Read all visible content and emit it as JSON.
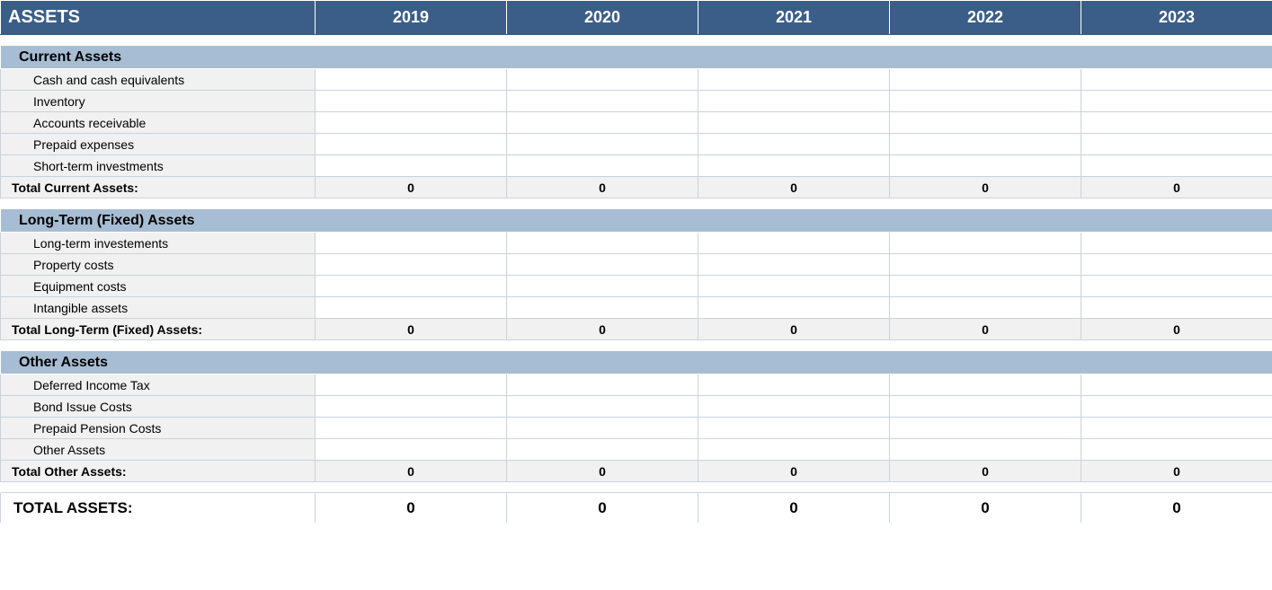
{
  "header": {
    "title": "ASSETS",
    "years": [
      "2019",
      "2020",
      "2021",
      "2022",
      "2023"
    ]
  },
  "sections": [
    {
      "title": "Current Assets",
      "items": [
        {
          "label": "Cash and cash equivalents",
          "values": [
            "",
            "",
            "",
            "",
            ""
          ]
        },
        {
          "label": "Inventory",
          "values": [
            "",
            "",
            "",
            "",
            ""
          ]
        },
        {
          "label": "Accounts receivable",
          "values": [
            "",
            "",
            "",
            "",
            ""
          ]
        },
        {
          "label": "Prepaid expenses",
          "values": [
            "",
            "",
            "",
            "",
            ""
          ]
        },
        {
          "label": "Short-term investments",
          "values": [
            "",
            "",
            "",
            "",
            ""
          ]
        }
      ],
      "total_label": "Total Current Assets:",
      "total_values": [
        "0",
        "0",
        "0",
        "0",
        "0"
      ]
    },
    {
      "title": "Long-Term (Fixed) Assets",
      "items": [
        {
          "label": "Long-term investements",
          "values": [
            "",
            "",
            "",
            "",
            ""
          ]
        },
        {
          "label": "Property costs",
          "values": [
            "",
            "",
            "",
            "",
            ""
          ]
        },
        {
          "label": "Equipment costs",
          "values": [
            "",
            "",
            "",
            "",
            ""
          ]
        },
        {
          "label": "Intangible assets",
          "values": [
            "",
            "",
            "",
            "",
            ""
          ]
        }
      ],
      "total_label": "Total Long-Term (Fixed) Assets:",
      "total_values": [
        "0",
        "0",
        "0",
        "0",
        "0"
      ]
    },
    {
      "title": "Other Assets",
      "items": [
        {
          "label": "Deferred Income Tax",
          "values": [
            "",
            "",
            "",
            "",
            ""
          ]
        },
        {
          "label": "Bond Issue Costs",
          "values": [
            "",
            "",
            "",
            "",
            ""
          ]
        },
        {
          "label": "Prepaid Pension Costs",
          "values": [
            "",
            "",
            "",
            "",
            ""
          ]
        },
        {
          "label": "Other Assets",
          "values": [
            "",
            "",
            "",
            "",
            ""
          ]
        }
      ],
      "total_label": "Total Other Assets:",
      "total_values": [
        "0",
        "0",
        "0",
        "0",
        "0"
      ]
    }
  ],
  "grand_total": {
    "label": "TOTAL ASSETS:",
    "values": [
      "0",
      "0",
      "0",
      "0",
      "0"
    ]
  }
}
